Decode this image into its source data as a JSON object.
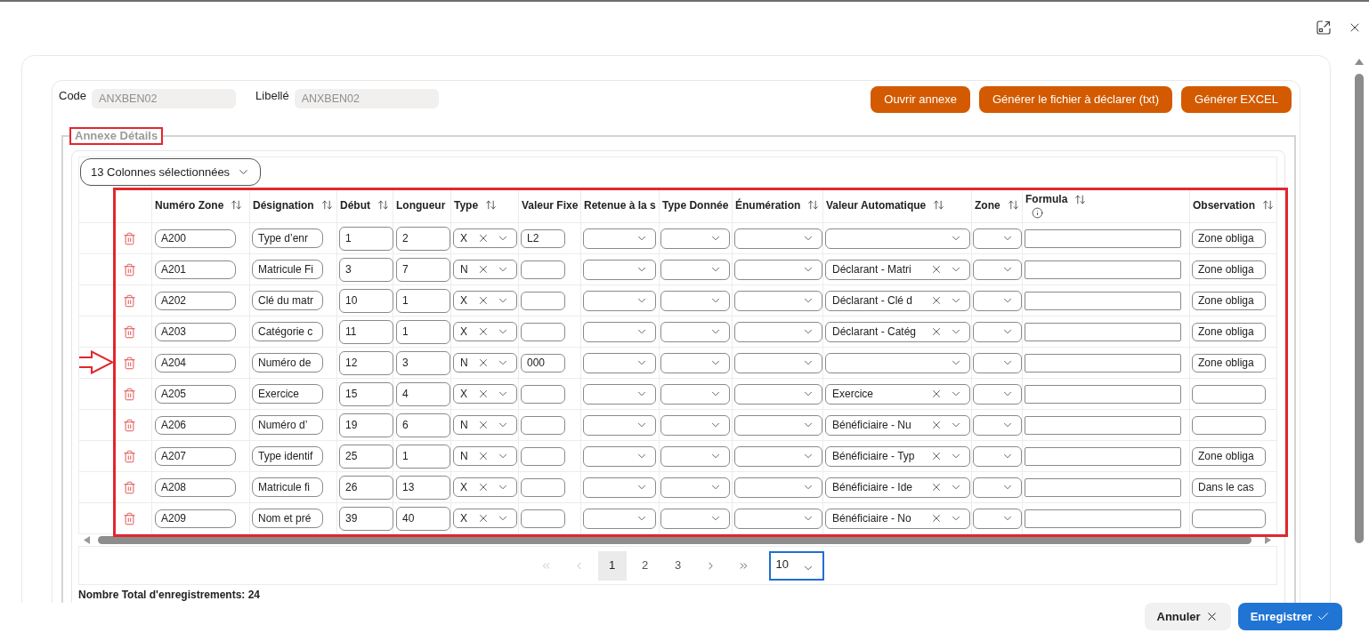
{
  "header": {
    "fields": [
      {
        "label": "Code",
        "value": "ANXBEN02",
        "disabled": true
      },
      {
        "label": "Libellé",
        "value": "ANXBEN02",
        "disabled": true
      }
    ],
    "actions": [
      "Ouvrir annexe",
      "Générer le fichier à déclarer (txt)",
      "Générer EXCEL"
    ]
  },
  "section": {
    "legend": "Annexe Détails",
    "highlighted": true,
    "column_picker": "13 Colonnes sélectionnées",
    "table": {
      "highlighted": true,
      "columns": [
        {
          "label": "Numéro Zone",
          "kind": "input",
          "sortable": true,
          "info": false
        },
        {
          "label": "Désignation",
          "kind": "input",
          "sortable": true,
          "info": false
        },
        {
          "label": "Début",
          "kind": "input",
          "sortable": true,
          "info": false
        },
        {
          "label": "Longueur",
          "kind": "input",
          "sortable": false,
          "info": false
        },
        {
          "label": "Type",
          "kind": "select",
          "sortable": true,
          "info": false
        },
        {
          "label": "Valeur Fixe",
          "kind": "input",
          "sortable": false,
          "info": false
        },
        {
          "label": "Retenue à la s",
          "kind": "select",
          "sortable": false,
          "info": false
        },
        {
          "label": "Type Donnée",
          "kind": "select",
          "sortable": false,
          "info": false
        },
        {
          "label": "Énumération",
          "kind": "select",
          "sortable": true,
          "info": false
        },
        {
          "label": "Valeur Automatique",
          "kind": "select",
          "sortable": true,
          "info": false
        },
        {
          "label": "Zone",
          "kind": "select",
          "sortable": true,
          "info": false
        },
        {
          "label": "Formula",
          "kind": "input",
          "sortable": true,
          "info": true
        },
        {
          "label": "Observation",
          "kind": "input",
          "sortable": true,
          "info": false
        }
      ],
      "rows": [
        {
          "marked": false,
          "cells": [
            "A200",
            "Type d’enr",
            "1",
            "2",
            "X",
            "L2",
            null,
            null,
            null,
            null,
            null,
            null,
            "Zone obliga"
          ]
        },
        {
          "marked": false,
          "cells": [
            "A201",
            "Matricule Fi",
            "3",
            "7",
            "N",
            null,
            null,
            null,
            null,
            "Déclarant - Matri",
            null,
            null,
            "Zone obliga"
          ]
        },
        {
          "marked": false,
          "cells": [
            "A202",
            "Clé du matr",
            "10",
            "1",
            "X",
            null,
            null,
            null,
            null,
            "Déclarant - Clé d",
            null,
            null,
            "Zone obliga"
          ]
        },
        {
          "marked": false,
          "cells": [
            "A203",
            "Catégorie c",
            "11",
            "1",
            "X",
            null,
            null,
            null,
            null,
            "Déclarant - Catég",
            null,
            null,
            "Zone obliga"
          ]
        },
        {
          "marked": true,
          "cells": [
            "A204",
            "Numéro de",
            "12",
            "3",
            "N",
            "000",
            null,
            null,
            null,
            null,
            null,
            null,
            "Zone obliga"
          ]
        },
        {
          "marked": false,
          "cells": [
            "A205",
            "Exercice",
            "15",
            "4",
            "X",
            null,
            null,
            null,
            null,
            "Exercice",
            null,
            null,
            null
          ]
        },
        {
          "marked": false,
          "cells": [
            "A206",
            "Numéro d’",
            "19",
            "6",
            "N",
            null,
            null,
            null,
            null,
            "Bénéficiaire - Nu",
            null,
            null,
            null
          ]
        },
        {
          "marked": false,
          "cells": [
            "A207",
            "Type identif",
            "25",
            "1",
            "N",
            null,
            null,
            null,
            null,
            "Bénéficiaire - Typ",
            null,
            null,
            "Zone obliga"
          ]
        },
        {
          "marked": false,
          "cells": [
            "A208",
            "Matricule fi",
            "26",
            "13",
            "X",
            null,
            null,
            null,
            null,
            "Bénéficiaire - Ide",
            null,
            null,
            "Dans le cas"
          ]
        },
        {
          "marked": false,
          "cells": [
            "A209",
            "Nom et pré",
            "39",
            "40",
            "X",
            null,
            null,
            null,
            null,
            "Bénéficiaire - No",
            null,
            null,
            null
          ]
        }
      ]
    },
    "pagination": {
      "back": [
        {
          "kind": "first",
          "disabled": true
        },
        {
          "kind": "prev",
          "disabled": true
        }
      ],
      "pages": [
        {
          "label": "1",
          "selected": true
        },
        {
          "label": "2",
          "selected": false
        },
        {
          "label": "3",
          "selected": false
        }
      ],
      "forward": [
        {
          "kind": "next",
          "disabled": false
        },
        {
          "kind": "last",
          "disabled": false
        }
      ],
      "page_size": {
        "value": "10",
        "focused": true
      }
    },
    "total": "Nombre Total d'enregistrements: 24"
  },
  "footer": {
    "buttons": [
      {
        "label": "Annuler",
        "kind": "cancel"
      },
      {
        "label": "Enregistrer",
        "kind": "save"
      }
    ]
  }
}
